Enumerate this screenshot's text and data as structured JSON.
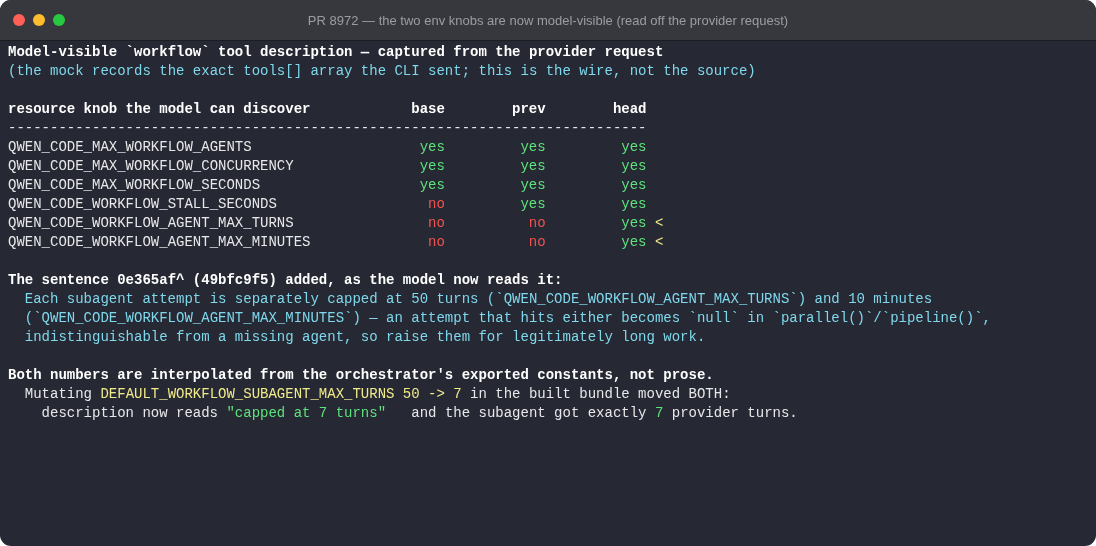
{
  "window": {
    "title": "PR 8972 — the two env knobs are now model-visible (read off the provider request)"
  },
  "heading": "Model-visible `workflow` tool description — captured from the provider request",
  "note": "(the mock records the exact tools[] array the CLI sent; this is the wire, not the source)",
  "table": {
    "columns": [
      "resource knob the model can discover",
      "base",
      "prev",
      "head"
    ],
    "rule": "----------------------------------------------------------------------------",
    "rows": [
      {
        "cells": [
          {
            "text": "QWEN_CODE_MAX_WORKFLOW_AGENTS",
            "kind": "name"
          },
          {
            "text": "yes",
            "kind": "ok"
          },
          {
            "text": "yes",
            "kind": "ok"
          },
          {
            "text": "yes",
            "kind": "ok"
          }
        ]
      },
      {
        "cells": [
          {
            "text": "QWEN_CODE_MAX_WORKFLOW_CONCURRENCY",
            "kind": "name"
          },
          {
            "text": "yes",
            "kind": "ok"
          },
          {
            "text": "yes",
            "kind": "ok"
          },
          {
            "text": "yes",
            "kind": "ok"
          }
        ]
      },
      {
        "cells": [
          {
            "text": "QWEN_CODE_MAX_WORKFLOW_SECONDS",
            "kind": "name"
          },
          {
            "text": "yes",
            "kind": "ok"
          },
          {
            "text": "yes",
            "kind": "ok"
          },
          {
            "text": "yes",
            "kind": "ok"
          }
        ]
      },
      {
        "cells": [
          {
            "text": "QWEN_CODE_WORKFLOW_STALL_SECONDS",
            "kind": "name"
          },
          {
            "text": "no",
            "kind": "fail"
          },
          {
            "text": "yes",
            "kind": "ok"
          },
          {
            "text": "yes",
            "kind": "ok"
          }
        ]
      },
      {
        "cells": [
          {
            "text": "QWEN_CODE_WORKFLOW_AGENT_MAX_TURNS",
            "kind": "name"
          },
          {
            "text": "no",
            "kind": "fail"
          },
          {
            "text": "no",
            "kind": "fail"
          },
          {
            "text": "yes",
            "kind": "ok"
          }
        ],
        "marker": "<"
      },
      {
        "cells": [
          {
            "text": "QWEN_CODE_WORKFLOW_AGENT_MAX_MINUTES",
            "kind": "name"
          },
          {
            "text": "no",
            "kind": "fail"
          },
          {
            "text": "no",
            "kind": "fail"
          },
          {
            "text": "yes",
            "kind": "ok"
          }
        ],
        "marker": "<"
      }
    ]
  },
  "sentence": {
    "heading": "The sentence 0e365af^ (49bfc9f5) added, as the model now reads it:",
    "lines": [
      "Each subagent attempt is separately capped at 50 turns (`QWEN_CODE_WORKFLOW_AGENT_MAX_TURNS`) and 10 minutes",
      "(`QWEN_CODE_WORKFLOW_AGENT_MAX_MINUTES`) — an attempt that hits either becomes `null` in `parallel()`/`pipeline()`,",
      "indistinguishable from a missing agent, so raise them for legitimately long work."
    ]
  },
  "summary": {
    "heading": "Both numbers are interpolated from the orchestrator's exported constants, not prose.",
    "lines": [
      [
        {
          "text": "Mutating ",
          "kind": "plain"
        },
        {
          "text": "DEFAULT_WORKFLOW_SUBAGENT_MAX_TURNS 50 -> 7",
          "kind": "constant"
        },
        {
          "text": " in the built bundle moved BOTH:",
          "kind": "plain"
        }
      ],
      [
        {
          "text": "description now reads ",
          "kind": "plain"
        },
        {
          "text": "\"capped at 7 turns\"",
          "kind": "value"
        },
        {
          "text": "   and the subagent got exactly ",
          "kind": "plain"
        },
        {
          "text": "7",
          "kind": "value"
        },
        {
          "text": " provider turns.",
          "kind": "plain"
        }
      ]
    ]
  }
}
